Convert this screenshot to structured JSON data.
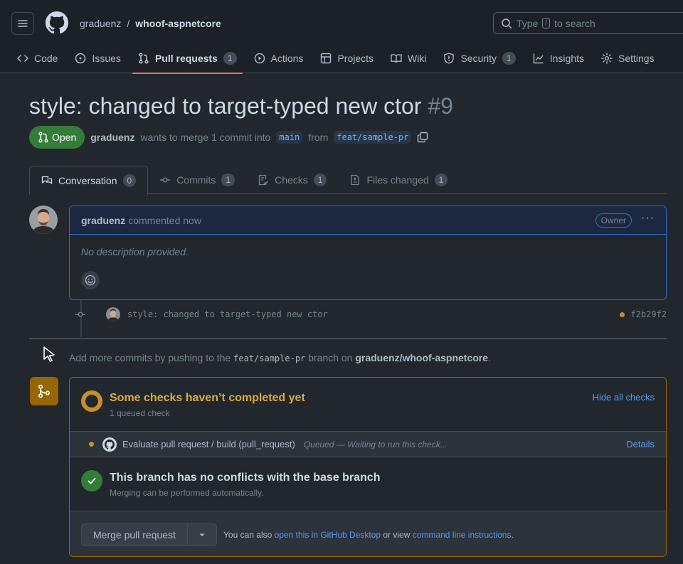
{
  "header": {
    "owner": "graduenz",
    "separator": "/",
    "repo": "whoof-aspnetcore",
    "search_prefix": "Type",
    "search_key": "/",
    "search_suffix": "to search"
  },
  "nav": {
    "code": "Code",
    "issues": "Issues",
    "pull_requests": "Pull requests",
    "pull_requests_count": "1",
    "actions": "Actions",
    "projects": "Projects",
    "wiki": "Wiki",
    "security": "Security",
    "security_count": "1",
    "insights": "Insights",
    "settings": "Settings"
  },
  "pr": {
    "title": "style: changed to target-typed new ctor",
    "number": "#9",
    "state": "Open",
    "author": "graduenz",
    "wants_to_merge": "wants to merge 1 commit into",
    "base_branch": "main",
    "from": "from",
    "head_branch": "feat/sample-pr"
  },
  "tabs": {
    "conversation": "Conversation",
    "conversation_count": "0",
    "commits": "Commits",
    "commits_count": "1",
    "checks": "Checks",
    "checks_count": "1",
    "files_changed": "Files changed",
    "files_changed_count": "1"
  },
  "comment": {
    "author": "graduenz",
    "action": "commented now",
    "role": "Owner",
    "menu": "···",
    "body": "No description provided."
  },
  "commit": {
    "message": "style: changed to target-typed new ctor",
    "sha": "f2b29f2"
  },
  "push_hint": {
    "prefix": "Add more commits by pushing to the",
    "branch": "feat/sample-pr",
    "middle": "branch on",
    "repo": "graduenz/whoof-aspnetcore",
    "suffix": "."
  },
  "checks": {
    "title": "Some checks haven’t completed yet",
    "subtitle": "1 queued check",
    "hide_all": "Hide all checks",
    "items": [
      {
        "name": "Evaluate pull request / build (pull_request)",
        "status": "Queued — Waiting to run this check...",
        "details": "Details"
      }
    ]
  },
  "conflicts": {
    "title": "This branch has no conflicts with the base branch",
    "subtitle": "Merging can be performed automatically."
  },
  "merge": {
    "button": "Merge pull request",
    "also": "You can also",
    "desktop_link": "open this in GitHub Desktop",
    "or_view": "or view",
    "cli_link": "command line instructions",
    "period": "."
  },
  "colors": {
    "accent_underline": "#ec775c",
    "open_green": "#347d39",
    "pending_yellow": "#c69026",
    "link_blue": "#539bf5"
  }
}
